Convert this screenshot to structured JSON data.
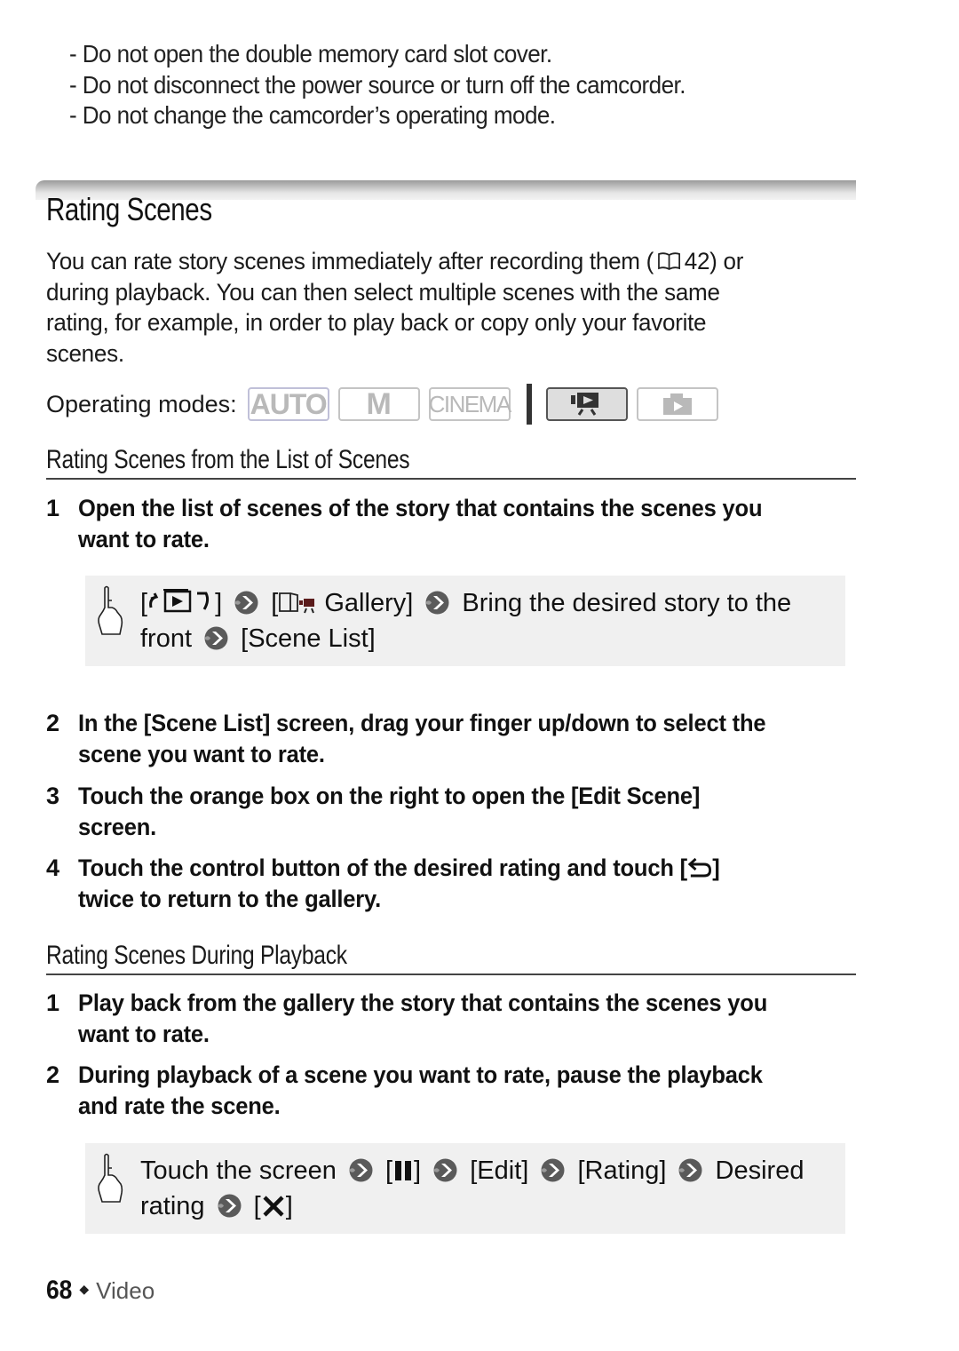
{
  "warnings": [
    "- Do not open the double memory card slot cover.",
    "- Do not disconnect the power source or turn off the camcorder.",
    "- Do not change the camcorder’s operating mode."
  ],
  "section": {
    "title": "Rating Scenes",
    "intro_lines": [
      "You can rate story scenes immediately after recording them (",
      "42) or",
      "during playback. You can then select multiple scenes with the same",
      "rating, for example, in order to play back or copy only your favorite",
      "scenes."
    ],
    "operating_modes": {
      "label": "Operating modes:",
      "modes": [
        {
          "name": "AUTO",
          "active": false
        },
        {
          "name": "M",
          "active": false
        },
        {
          "name": "CINEMA",
          "active": false
        },
        {
          "name": "video-playback",
          "active": true
        },
        {
          "name": "photo-playback",
          "active": false
        }
      ]
    }
  },
  "list_of_scenes": {
    "heading": "Rating Scenes from the List of Scenes",
    "steps": [
      {
        "num": "1",
        "lines": [
          "Open the list of scenes of the story that contains the scenes you",
          "want to rate."
        ]
      },
      {
        "num": "2",
        "lines": [
          "In the [Scene List] screen, drag your finger up/down to select the",
          "scene you want to rate."
        ]
      },
      {
        "num": "3",
        "lines": [
          "Touch the orange box on the right to open the [Edit Scene]",
          "screen."
        ]
      },
      {
        "num": "4",
        "lines": [
          "Touch the control button of the desired rating and touch [",
          "]",
          "twice to return to the gallery."
        ]
      }
    ],
    "procedure": {
      "bracket_open": "[",
      "bracket_close": "]",
      "gallery": "Gallery]",
      "bring": "Bring the desired story to the",
      "front": "front",
      "scene_list": "[Scene List]"
    }
  },
  "during_playback": {
    "heading": "Rating Scenes During Playback",
    "steps": [
      {
        "num": "1",
        "lines": [
          "Play back from the gallery the story that contains the scenes you",
          "want to rate."
        ]
      },
      {
        "num": "2",
        "lines": [
          "During playback of a scene you want to rate, pause the playback",
          "and rate the scene."
        ]
      }
    ],
    "procedure": {
      "touch": "Touch the screen",
      "pause_open": "[",
      "pause_close": "]",
      "edit": "[Edit]",
      "rating": "[Rating]",
      "desired": "Desired",
      "rating_word": "rating",
      "close_open": "[",
      "close_close": "]"
    }
  },
  "footer": {
    "page_number": "68",
    "separator": "◆",
    "section": "Video"
  }
}
